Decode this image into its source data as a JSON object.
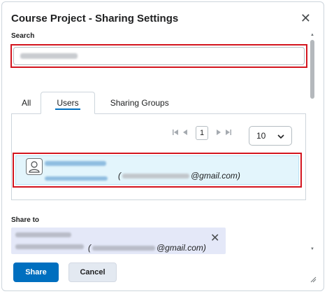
{
  "dialog": {
    "title": "Course Project - Sharing Settings",
    "close_icon": "close-icon"
  },
  "search": {
    "label": "Search",
    "value": "",
    "placeholder": ""
  },
  "tabs": [
    {
      "label": "All",
      "active": false
    },
    {
      "label": "Users",
      "active": true
    },
    {
      "label": "Sharing Groups",
      "active": false
    }
  ],
  "pager": {
    "first_icon": "first-page-icon",
    "prev_icon": "prev-page-icon",
    "current_page": "1",
    "next_icon": "next-page-icon",
    "last_icon": "last-page-icon",
    "per_page": "10"
  },
  "user_result": {
    "email_prefix": "(",
    "email_suffix": "@gmail.com)"
  },
  "share_to": {
    "label": "Share to",
    "email_prefix": "(",
    "email_suffix": "@gmail.com)"
  },
  "buttons": {
    "share": "Share",
    "cancel": "Cancel"
  },
  "colors": {
    "primary": "#006fbf",
    "highlight_red": "#d3151f",
    "selected_row_bg": "#e3f5fc",
    "share_item_bg": "#e4e8f8"
  }
}
